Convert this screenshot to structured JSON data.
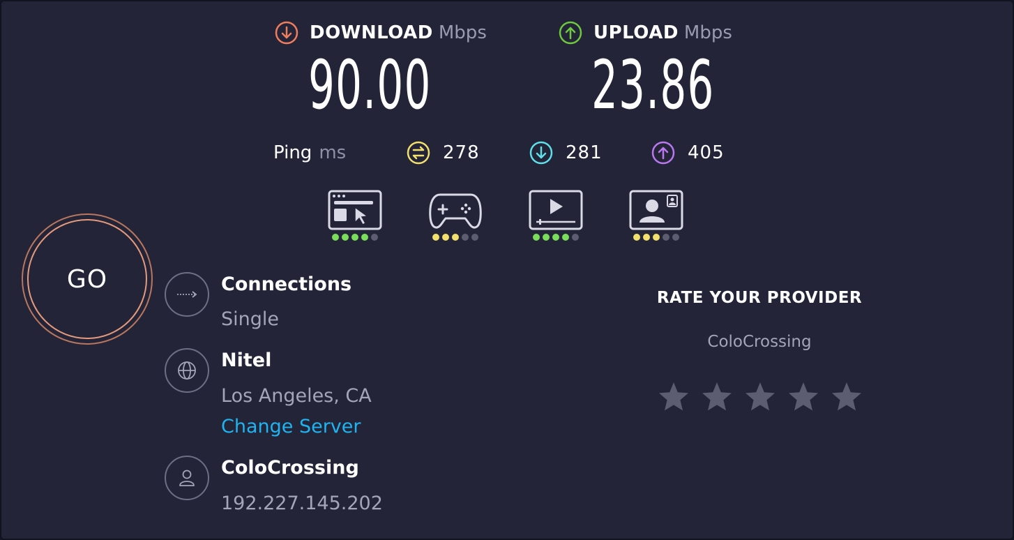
{
  "download": {
    "label": "DOWNLOAD",
    "unit": "Mbps",
    "value": "90.00",
    "color": "#f07d5e"
  },
  "upload": {
    "label": "UPLOAD",
    "unit": "Mbps",
    "value": "23.86",
    "color": "#6ec93e"
  },
  "ping": {
    "label": "Ping",
    "unit": "ms",
    "idle": {
      "value": "278",
      "icon": "ping-jitter-icon",
      "color": "#f2e06c"
    },
    "download": {
      "value": "281",
      "icon": "download-latency-icon",
      "color": "#5fdfe8"
    },
    "upload": {
      "value": "405",
      "icon": "upload-latency-icon",
      "color": "#b978f0"
    }
  },
  "quality": [
    {
      "name": "browsing",
      "icon": "browser-cursor-icon",
      "rating": 4,
      "max": 5,
      "color": "#7bde5a"
    },
    {
      "name": "gaming",
      "icon": "gamepad-icon",
      "rating": 3,
      "max": 5,
      "color": "#f2e06c"
    },
    {
      "name": "streaming",
      "icon": "video-play-icon",
      "rating": 4,
      "max": 5,
      "color": "#7bde5a"
    },
    {
      "name": "video-chat",
      "icon": "video-call-icon",
      "rating": 3,
      "max": 5,
      "color": "#f2e06c"
    }
  ],
  "go": {
    "label": "GO"
  },
  "connections": {
    "title": "Connections",
    "value": "Single"
  },
  "server": {
    "name": "Nitel",
    "location": "Los Angeles, CA",
    "change_label": "Change Server"
  },
  "provider": {
    "name": "ColoCrossing",
    "ip": "192.227.145.202"
  },
  "rate": {
    "title": "RATE YOUR PROVIDER",
    "provider": "ColoCrossing",
    "stars": 5,
    "star_color": "#5c5d70"
  }
}
